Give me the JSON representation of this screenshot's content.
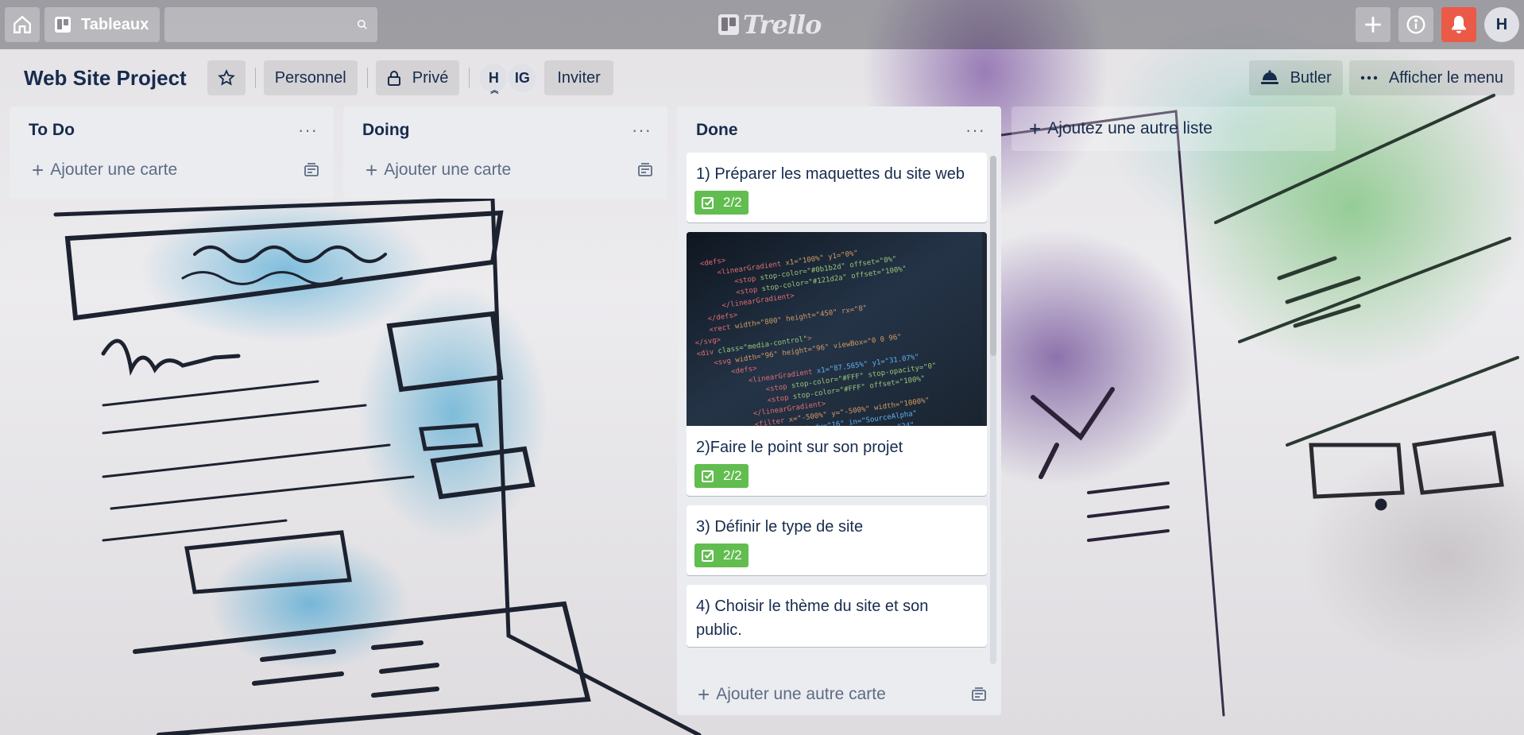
{
  "header": {
    "home_icon": "home-icon",
    "boards_label": "Tableaux",
    "search_placeholder": "",
    "logo_text": "Trello",
    "avatar_initial": "H"
  },
  "board": {
    "title": "Web Site Project",
    "visibility_team": "Personnel",
    "visibility_privacy": "Privé",
    "members": [
      "H",
      "IG"
    ],
    "invite_label": "Inviter",
    "butler_label": "Butler",
    "menu_label": "Afficher le menu"
  },
  "lists": [
    {
      "title": "To Do",
      "add_card_label": "Ajouter une carte",
      "cards": []
    },
    {
      "title": "Doing",
      "add_card_label": "Ajouter une carte",
      "cards": []
    },
    {
      "title": "Done",
      "add_card_label": "Ajouter une autre carte",
      "cards": [
        {
          "title": "1) Préparer les maquettes du site web",
          "checklist": "2/2"
        },
        {
          "title": "2)Faire le point sur son projet",
          "checklist": "2/2",
          "cover": "code-screenshot-image"
        },
        {
          "title": "3) Définir le type de site",
          "checklist": "2/2"
        },
        {
          "title": "4) Choisir le thème du site et son public."
        }
      ]
    }
  ],
  "add_list_label": "Ajoutez une autre liste",
  "colors": {
    "badge_green": "#61bd4f",
    "notification_red": "#eb5a46",
    "list_bg": "#ebecf0"
  },
  "scroll_position": 0
}
